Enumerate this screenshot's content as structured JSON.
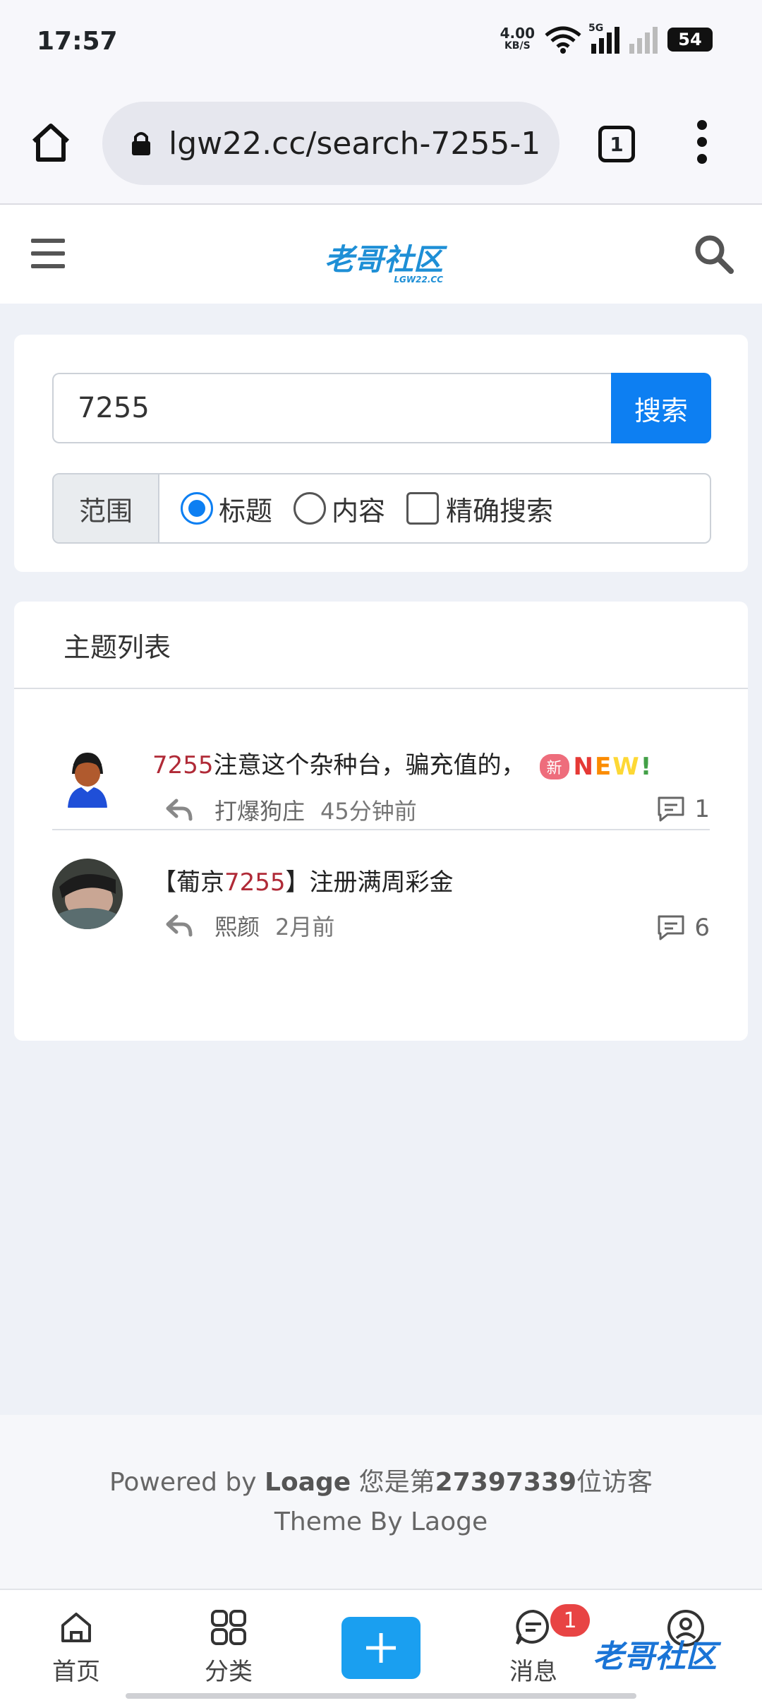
{
  "status_bar": {
    "time": "17:57",
    "net_speed": "4.00",
    "net_unit": "KB/S",
    "signal_label": "5G",
    "battery": "54"
  },
  "browser": {
    "url": "lgw22.cc/search-7255-1",
    "tab_count": "1"
  },
  "site": {
    "logo_text": "老哥社区",
    "logo_sub": "LGW22.CC"
  },
  "search": {
    "query": "7255",
    "button_label": "搜索",
    "scope_label": "范围",
    "options": [
      {
        "label": "标题",
        "checked": true
      },
      {
        "label": "内容",
        "checked": false
      },
      {
        "label": "精确搜索",
        "checked": false
      }
    ]
  },
  "topic_list": {
    "header": "主题列表",
    "topics": [
      {
        "title_highlight": "7255",
        "title_rest": "注意这个杂种台，骗充值的，",
        "badge": "新",
        "new_art": "NEW!",
        "author": "打爆狗庄",
        "time": "45分钟前",
        "comments": "1"
      },
      {
        "title_prefix": "【葡京",
        "title_highlight": "7255",
        "title_rest": "】注册满周彩金",
        "author": "熙颜",
        "time": "2月前",
        "comments": "6"
      }
    ]
  },
  "footer": {
    "powered_prefix": "Powered by ",
    "powered_name": "Loage",
    "visitor_prefix": " 您是第",
    "visitor_count": "27397339",
    "visitor_suffix": "位访客",
    "theme": "Theme By Laoge"
  },
  "bottom_nav": {
    "home": "首页",
    "category": "分类",
    "messages": "消息",
    "message_badge": "1",
    "watermark": "老哥社区"
  },
  "colors": {
    "primary": "#0d7ff2",
    "highlight": "#b02a37",
    "badge": "#ee6d7c"
  }
}
